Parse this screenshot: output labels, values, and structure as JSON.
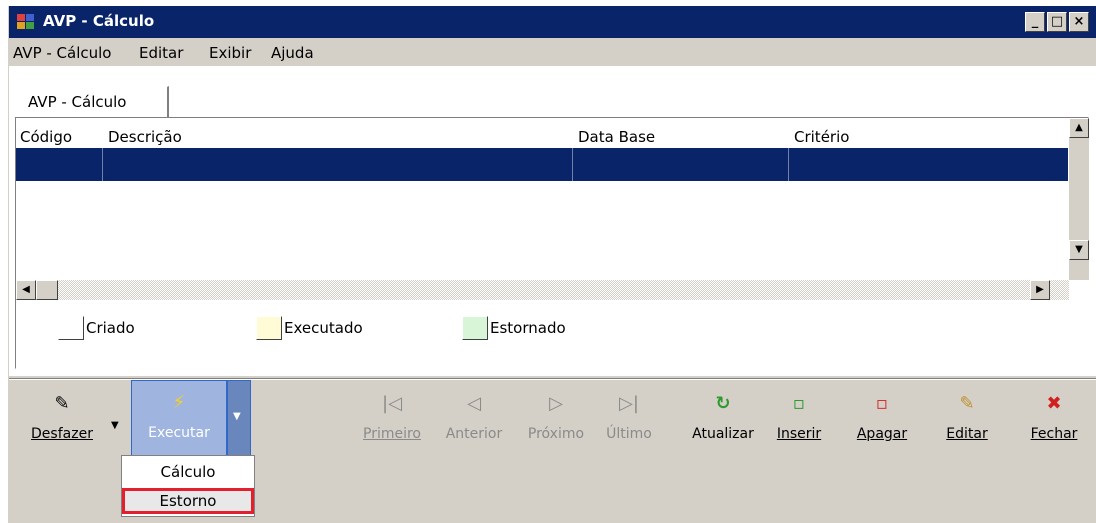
{
  "window": {
    "title": "AVP - Cálculo"
  },
  "menu": [
    "AVP - Cálculo",
    "Editar",
    "Exibir",
    "Ajuda"
  ],
  "tab": {
    "label": "AVP - Cálculo"
  },
  "grid": {
    "columns": [
      "Código",
      "Descrição",
      "Data Base",
      "Critério"
    ]
  },
  "legend": [
    {
      "label": "Criado",
      "color": "#ffffff"
    },
    {
      "label": "Executado",
      "color": "#fffbd6"
    },
    {
      "label": "Estornado",
      "color": "#d8f5d8"
    }
  ],
  "toolbar": {
    "desfazer": "Desfazer",
    "executar": "Executar",
    "primeiro": "Primeiro",
    "anterior": "Anterior",
    "proximo": "Próximo",
    "ultimo": "Último",
    "atualizar": "Atualizar",
    "inserir": "Inserir",
    "apagar": "Apagar",
    "editar": "Editar",
    "fechar": "Fechar"
  },
  "dropdown": {
    "items": [
      "Cálculo",
      "Estorno"
    ],
    "highlighted": "Estorno"
  },
  "colors": {
    "title_bar": "#0a246a",
    "selection": "#0a246a",
    "highlight_border": "#e5202e"
  }
}
